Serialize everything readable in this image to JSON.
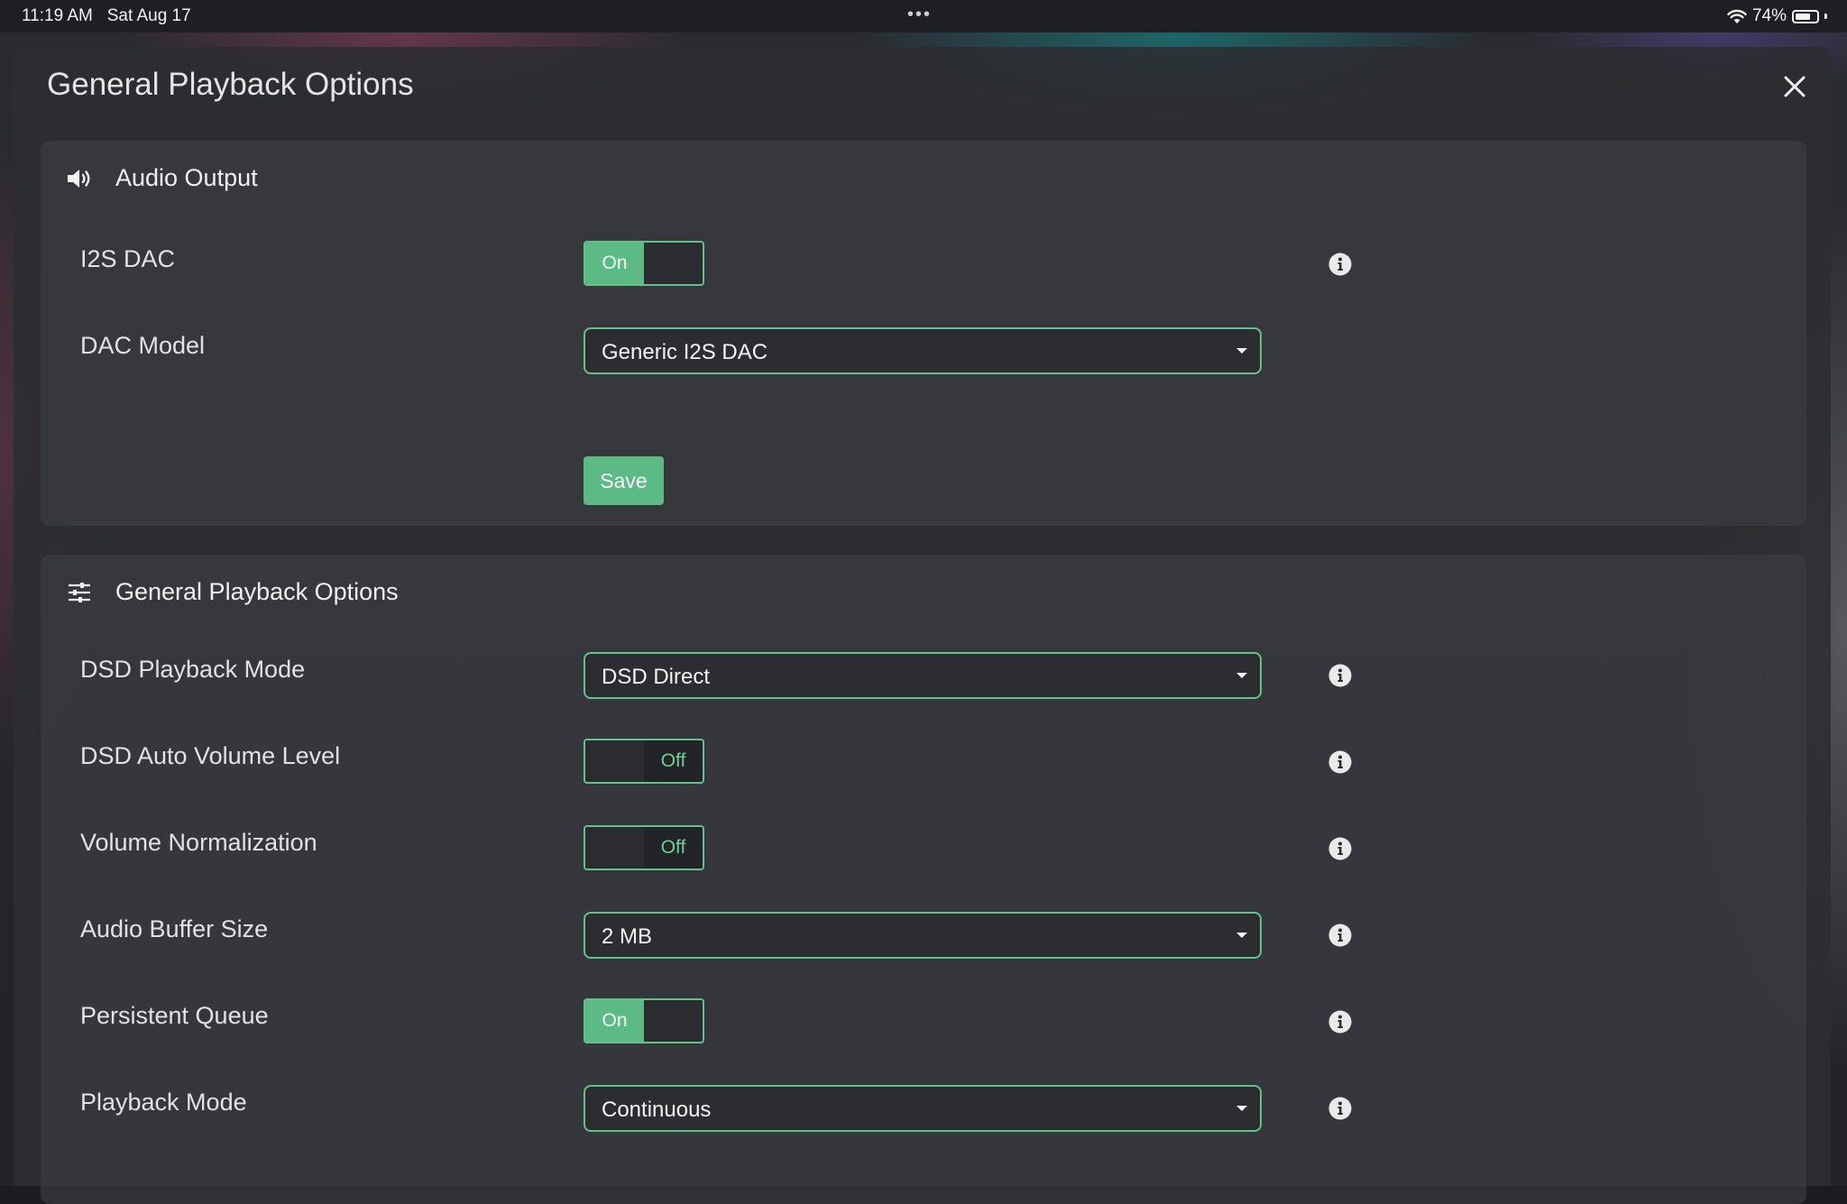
{
  "status_bar": {
    "time": "11:19 AM",
    "date": "Sat Aug 17",
    "dots": "•••",
    "battery": "74%",
    "battery_level": 0.74
  },
  "modal": {
    "title": "General Playback Options",
    "close_icon": "close-icon"
  },
  "audio_output": {
    "title": "Audio Output",
    "icon": "speaker-icon",
    "i2s_dac": {
      "label": "I2S DAC",
      "state": "On"
    },
    "dac_model": {
      "label": "DAC Model",
      "value": "Generic I2S DAC"
    },
    "save_label": "Save"
  },
  "general_playback": {
    "title": "General Playback Options",
    "icon": "sliders-icon",
    "dsd_playback_mode": {
      "label": "DSD Playback Mode",
      "value": "DSD Direct"
    },
    "dsd_auto_volume": {
      "label": "DSD Auto Volume Level",
      "state": "Off"
    },
    "volume_normalization": {
      "label": "Volume Normalization",
      "state": "Off"
    },
    "audio_buffer_size": {
      "label": "Audio Buffer Size",
      "value": "2 MB"
    },
    "persistent_queue": {
      "label": "Persistent Queue",
      "state": "On"
    },
    "playback_mode": {
      "label": "Playback Mode",
      "value": "Continuous"
    }
  },
  "colors": {
    "accent": "#5cbb85",
    "accent_border": "#66c08a",
    "panel": "#3e3f43",
    "modal": "#2c2d31"
  }
}
